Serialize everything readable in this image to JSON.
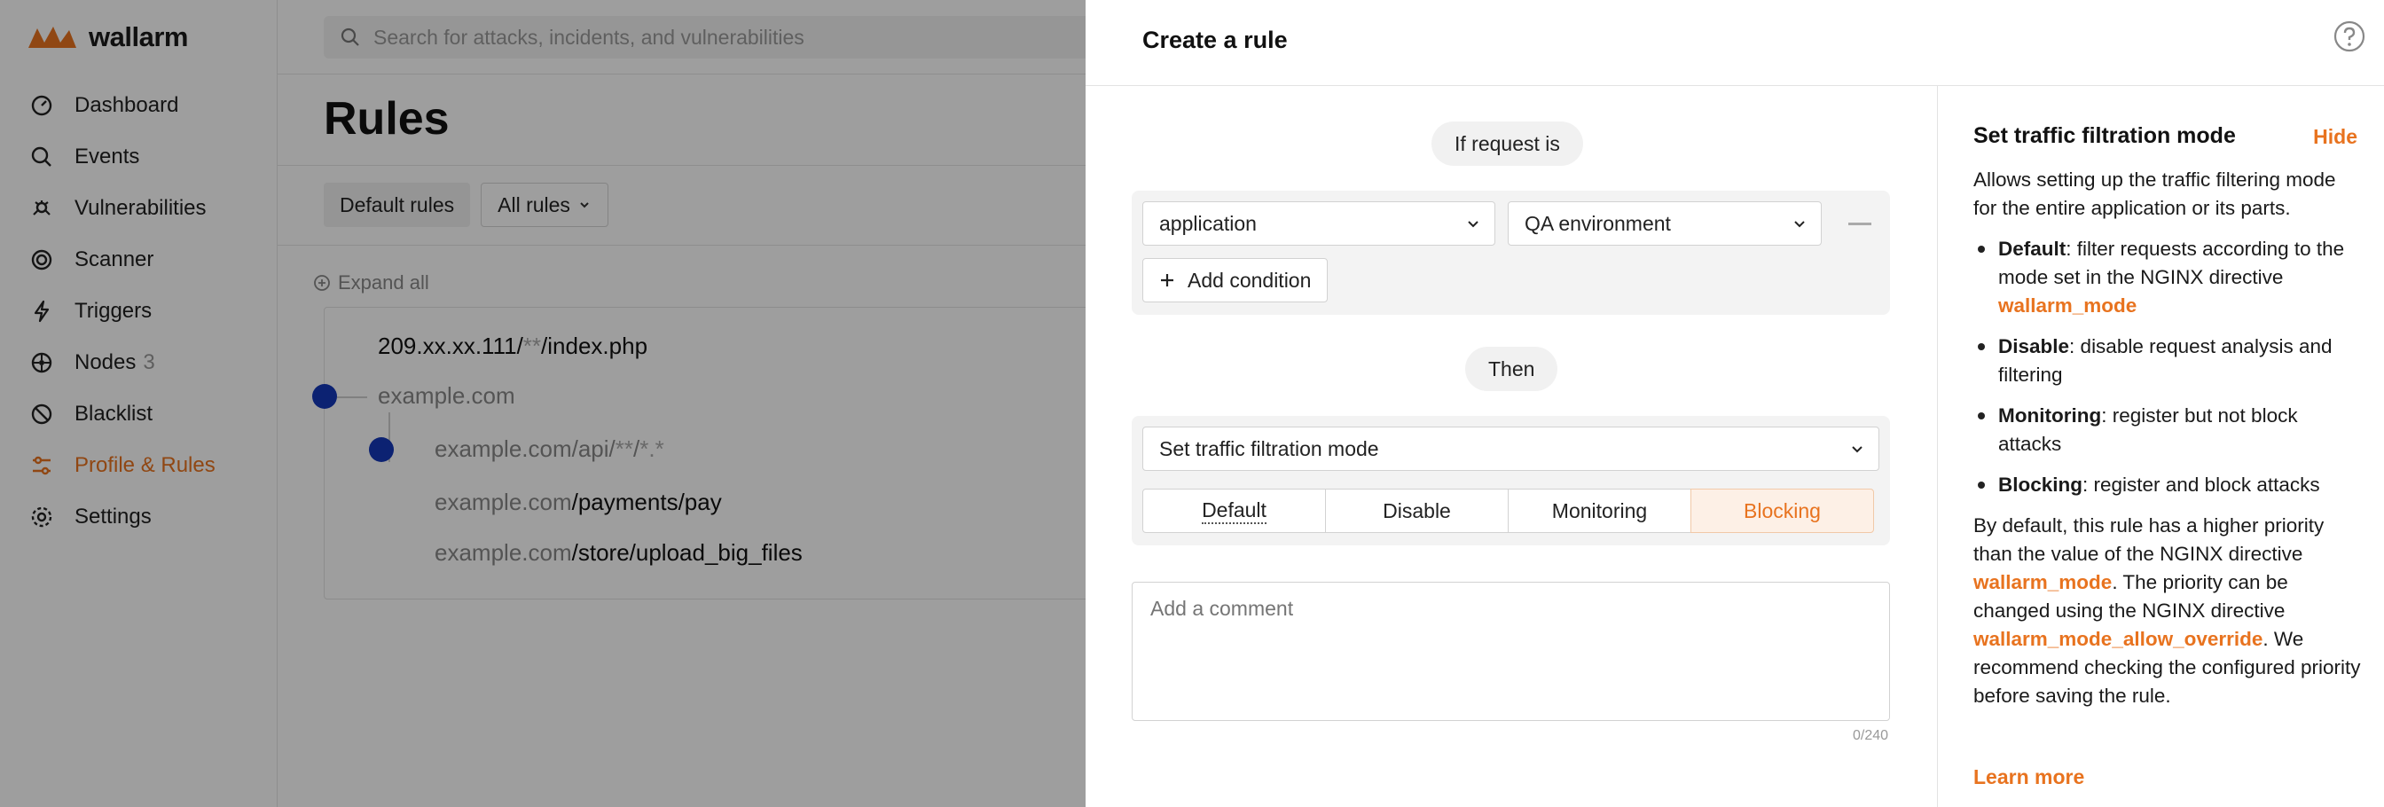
{
  "app": {
    "brand": "wallarm",
    "search_placeholder": "Search for attacks, incidents, and vulnerabilities",
    "nav": [
      {
        "label": "Dashboard",
        "icon": "dashboard-icon"
      },
      {
        "label": "Events",
        "icon": "search-icon"
      },
      {
        "label": "Vulnerabilities",
        "icon": "bug-icon"
      },
      {
        "label": "Scanner",
        "icon": "scanner-icon"
      },
      {
        "label": "Triggers",
        "icon": "bolt-icon"
      },
      {
        "label": "Nodes",
        "count": "3",
        "icon": "nodes-icon"
      },
      {
        "label": "Blacklist",
        "icon": "blacklist-icon"
      },
      {
        "label": "Profile & Rules",
        "icon": "sliders-icon",
        "active": true
      },
      {
        "label": "Settings",
        "icon": "gear-icon"
      }
    ],
    "accent_color": "#e8731f"
  },
  "rules_page": {
    "title": "Rules",
    "filter_default": "Default rules",
    "filter_all": "All rules",
    "expand_all": "Expand all",
    "tree": {
      "r1_host": "209.xx.xx.111/",
      "r1_glob": "**",
      "r1_path": "/index.php",
      "r2_host": "example.com",
      "r3_host": "example.com",
      "r3_a": "/api/",
      "r3_glob1": "**",
      "r3_sep": "/",
      "r3_glob2": "*.*",
      "r4_host": "example.com",
      "r4_path": "/payments/pay",
      "r5_host": "example.com",
      "r5_path": "/store/upload_big_files"
    }
  },
  "drawer": {
    "title": "Create a rule",
    "if_label": "If request is",
    "condition_field": "application",
    "condition_value": "QA environment",
    "add_condition": "Add condition",
    "then_label": "Then",
    "action": "Set traffic filtration mode",
    "modes": [
      "Default",
      "Disable",
      "Monitoring",
      "Blocking"
    ],
    "selected_mode": "Blocking",
    "comment_placeholder": "Add a comment",
    "comment_counter": "0/240"
  },
  "help": {
    "title": "Set traffic filtration mode",
    "hide": "Hide",
    "intro": "Allows setting up the traffic filtering mode for the entire application or its parts.",
    "items": [
      {
        "term": "Default",
        "text": ": filter requests according to the mode set in the NGINX directive ",
        "code": "wallarm_mode"
      },
      {
        "term": "Disable",
        "text": ": disable request analysis and filtering"
      },
      {
        "term": "Monitoring",
        "text": ": register but not block attacks"
      },
      {
        "term": "Blocking",
        "text": ": register and block attacks"
      }
    ],
    "outro_1": "By default, this rule has a higher priority than the value of the NGINX directive ",
    "outro_code_1": "wallarm_mode",
    "outro_2": ". The priority can be changed using the NGINX directive ",
    "outro_code_2": "wallarm_mode_allow_override",
    "outro_3": ". We recommend checking the configured priority before saving the rule.",
    "learn_more": "Learn more"
  }
}
